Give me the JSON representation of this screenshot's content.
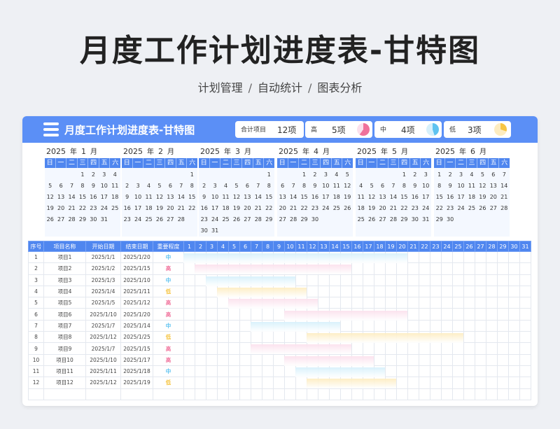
{
  "title": "月度工作计划进度表-甘特图",
  "subtitle": [
    "计划管理",
    "自动统计",
    "图表分析"
  ],
  "subtitle_sep": "/",
  "header": {
    "title": "月度工作计划进度表-甘特图",
    "stats": [
      {
        "label": "合计项目",
        "value": "12项"
      },
      {
        "label": "高",
        "value": "5项",
        "color": "#f0719b"
      },
      {
        "label": "中",
        "value": "4项",
        "color": "#5ec3f0"
      },
      {
        "label": "低",
        "value": "3项",
        "color": "#f6c544"
      }
    ]
  },
  "calendar": {
    "year_unit": "年",
    "month_unit": "月",
    "weekdays": [
      "日",
      "一",
      "二",
      "三",
      "四",
      "五",
      "六"
    ],
    "months": [
      {
        "year": "2025",
        "month": "1",
        "start": 3,
        "days": 31
      },
      {
        "year": "2025",
        "month": "2",
        "start": 6,
        "days": 28
      },
      {
        "year": "2025",
        "month": "3",
        "start": 6,
        "days": 31
      },
      {
        "year": "2025",
        "month": "4",
        "start": 2,
        "days": 30
      },
      {
        "year": "2025",
        "month": "5",
        "start": 4,
        "days": 31
      },
      {
        "year": "2025",
        "month": "6",
        "start": 0,
        "days": 30
      }
    ]
  },
  "table": {
    "headers": [
      "序号",
      "项目名称",
      "开始日期",
      "结束日期",
      "重要程度"
    ],
    "day_headers": [
      "1",
      "2",
      "3",
      "4",
      "5",
      "6",
      "7",
      "8",
      "9",
      "10",
      "11",
      "12",
      "13",
      "14",
      "15",
      "16",
      "17",
      "18",
      "19",
      "20",
      "21",
      "22",
      "23",
      "24",
      "25",
      "26",
      "27",
      "28",
      "29",
      "30",
      "31"
    ],
    "rows": [
      {
        "no": "1",
        "name": "项目1",
        "start": "2025/1/1",
        "end": "2025/1/20",
        "prio": "中",
        "s": 1,
        "e": 20
      },
      {
        "no": "2",
        "name": "项目2",
        "start": "2025/1/2",
        "end": "2025/1/15",
        "prio": "高",
        "s": 2,
        "e": 15
      },
      {
        "no": "3",
        "name": "项目3",
        "start": "2025/1/3",
        "end": "2025/1/10",
        "prio": "中",
        "s": 3,
        "e": 10
      },
      {
        "no": "4",
        "name": "项目4",
        "start": "2025/1/4",
        "end": "2025/1/11",
        "prio": "低",
        "s": 4,
        "e": 11
      },
      {
        "no": "5",
        "name": "项目5",
        "start": "2025/1/5",
        "end": "2025/1/12",
        "prio": "高",
        "s": 5,
        "e": 12
      },
      {
        "no": "6",
        "name": "项目6",
        "start": "2025/1/10",
        "end": "2025/1/20",
        "prio": "高",
        "s": 10,
        "e": 20
      },
      {
        "no": "7",
        "name": "项目7",
        "start": "2025/1/7",
        "end": "2025/1/14",
        "prio": "中",
        "s": 7,
        "e": 14
      },
      {
        "no": "8",
        "name": "项目8",
        "start": "2025/1/12",
        "end": "2025/1/25",
        "prio": "低",
        "s": 12,
        "e": 25
      },
      {
        "no": "9",
        "name": "项目9",
        "start": "2025/1/7",
        "end": "2025/1/15",
        "prio": "高",
        "s": 7,
        "e": 15
      },
      {
        "no": "10",
        "name": "项目10",
        "start": "2025/1/10",
        "end": "2025/1/17",
        "prio": "高",
        "s": 10,
        "e": 17
      },
      {
        "no": "11",
        "name": "项目11",
        "start": "2025/1/11",
        "end": "2025/1/18",
        "prio": "中",
        "s": 11,
        "e": 18
      },
      {
        "no": "12",
        "name": "项目12",
        "start": "2025/1/12",
        "end": "2025/1/19",
        "prio": "低",
        "s": 12,
        "e": 19
      }
    ]
  },
  "colors": {
    "accent": "#5b8ff6",
    "high": "#f0719b",
    "mid": "#5ec3f0",
    "low": "#f6c544",
    "bar_high": "#fbe0ec",
    "bar_mid": "#d6f0fb",
    "bar_low": "#fdecc0"
  }
}
